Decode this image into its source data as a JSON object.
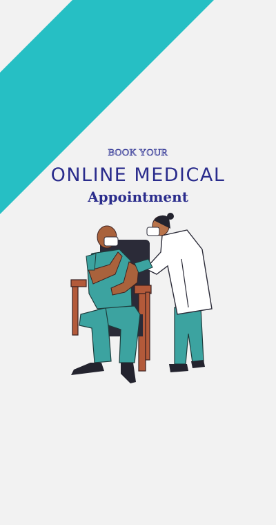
{
  "colors": {
    "background": "#f2f2f2",
    "accent_stripe": "#26bfc4",
    "title_navy": "#2a2c8c",
    "scrub_teal": "#3ca3a0",
    "chair_brown": "#b35a3a"
  },
  "headline": {
    "kicker": "BOOK YOUR",
    "title": "ONLINE MEDICAL",
    "subtitle": "Appointment"
  },
  "illustration": {
    "icon": "vaccination-illustration-icon"
  }
}
